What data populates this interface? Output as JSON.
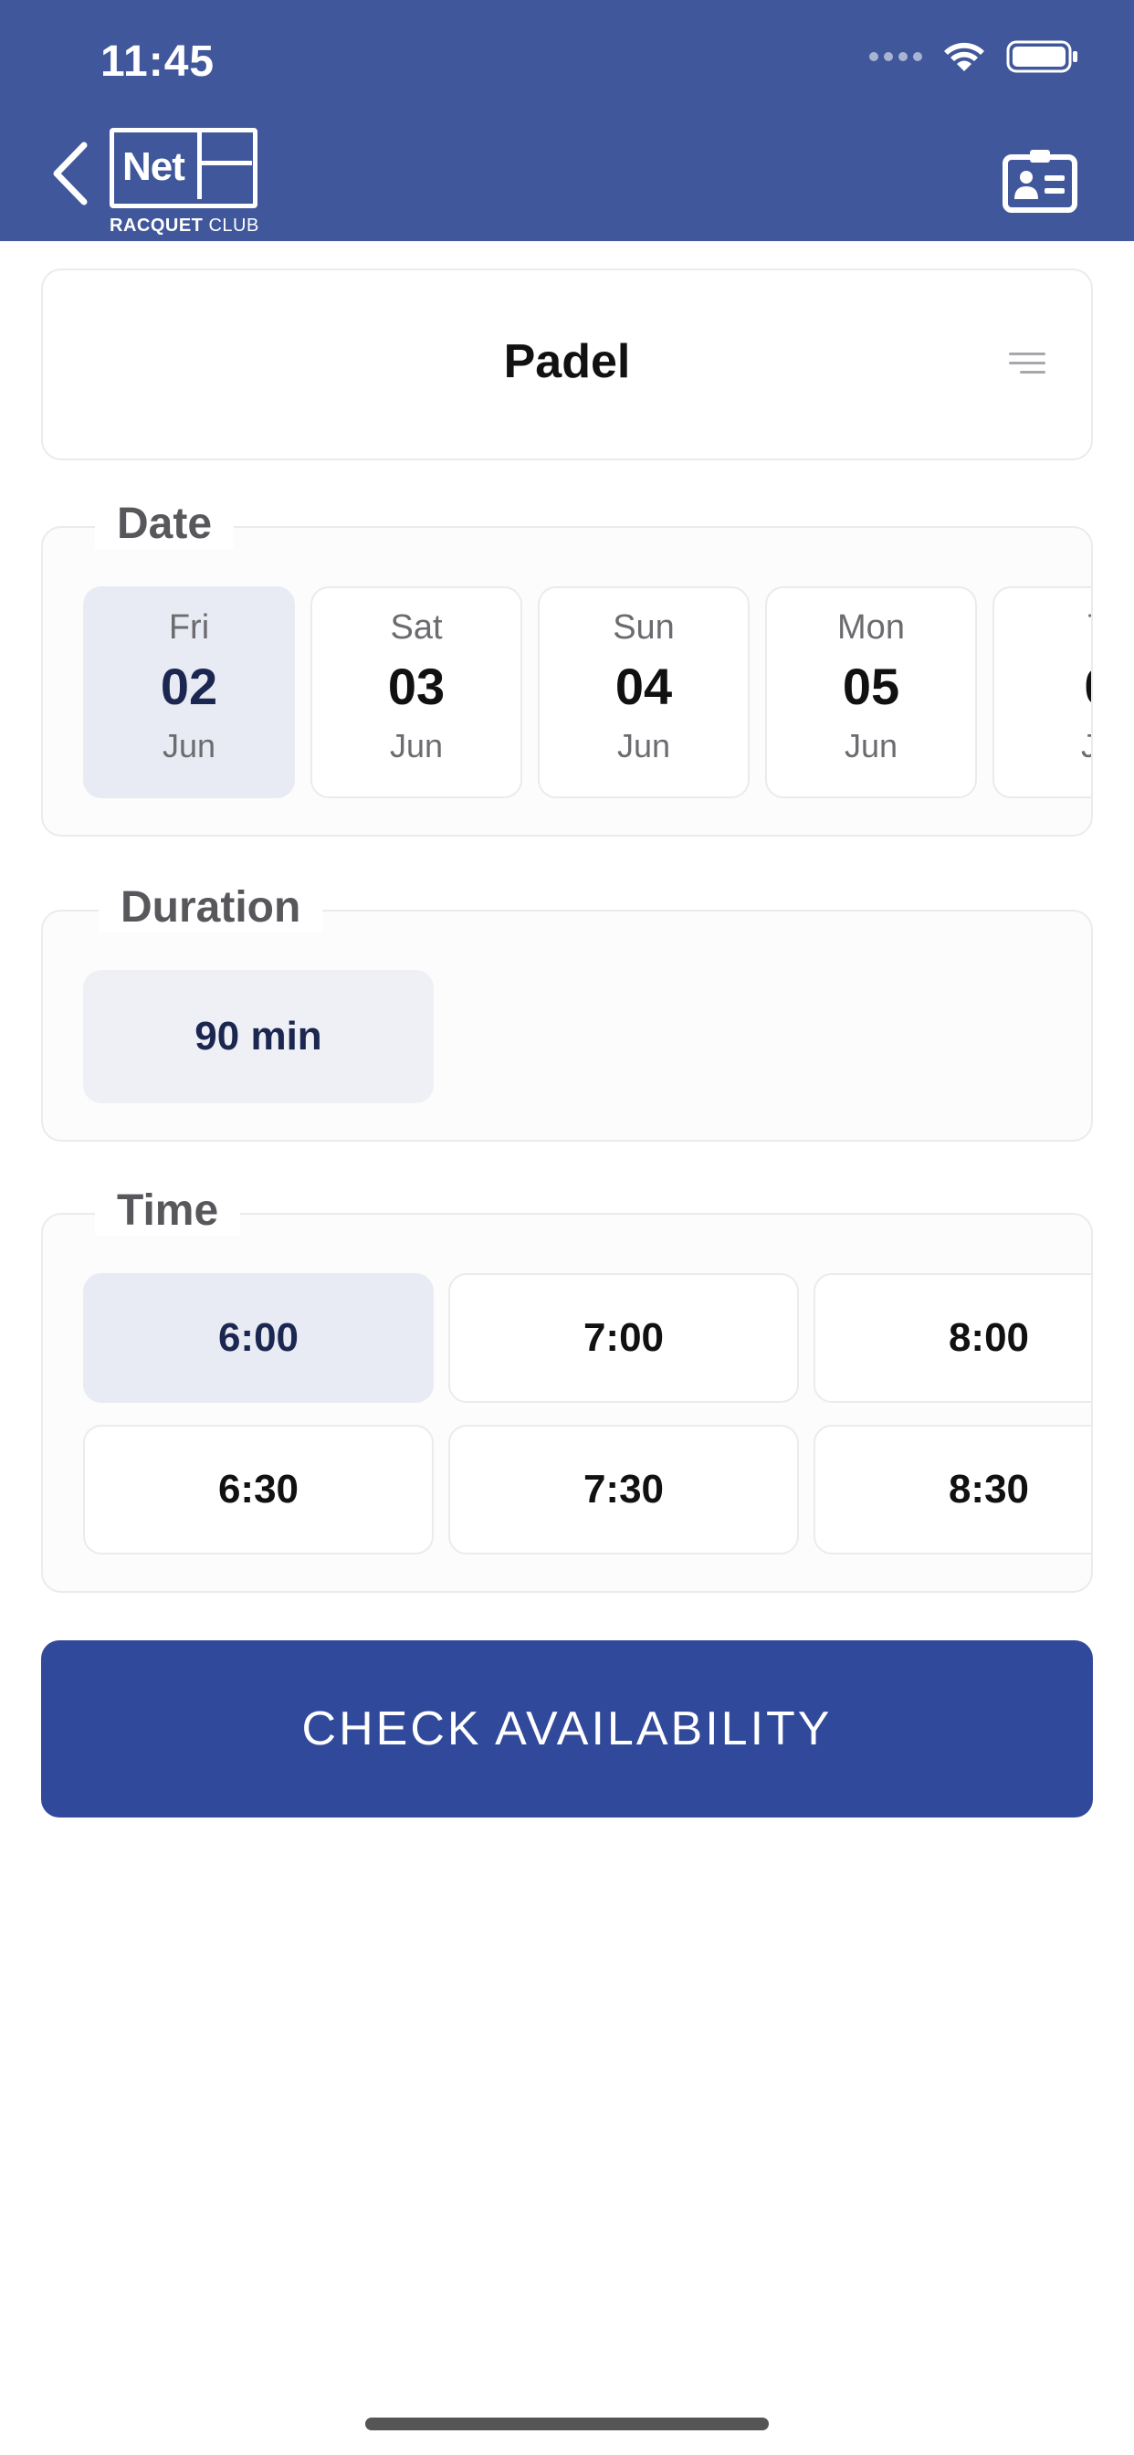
{
  "status_bar": {
    "time": "11:45"
  },
  "header": {
    "logo_text": "Net",
    "logo_sub_bold": "RACQUET",
    "logo_sub_thin": "CLUB"
  },
  "sport": {
    "title": "Padel"
  },
  "date_section": {
    "legend": "Date",
    "items": [
      {
        "dow": "Fri",
        "day": "02",
        "month": "Jun",
        "selected": true
      },
      {
        "dow": "Sat",
        "day": "03",
        "month": "Jun",
        "selected": false
      },
      {
        "dow": "Sun",
        "day": "04",
        "month": "Jun",
        "selected": false
      },
      {
        "dow": "Mon",
        "day": "05",
        "month": "Jun",
        "selected": false
      },
      {
        "dow": "T",
        "day": "0",
        "month": "Ju",
        "selected": false
      }
    ]
  },
  "duration_section": {
    "legend": "Duration",
    "value": "90 min"
  },
  "time_section": {
    "legend": "Time",
    "slots": [
      "6:00",
      "7:00",
      "8:00",
      "6:30",
      "7:30",
      "8:30"
    ],
    "selected": "6:00"
  },
  "cta": {
    "label": "CHECK AVAILABILITY"
  },
  "colors": {
    "primary": "#31499a",
    "header": "#40579b",
    "selected": "#e8ebf3"
  },
  "icons": {
    "back": "chevron-left-icon",
    "card": "id-card-icon",
    "menu": "hamburger-icon",
    "wifi": "wifi-icon",
    "battery": "battery-icon"
  }
}
